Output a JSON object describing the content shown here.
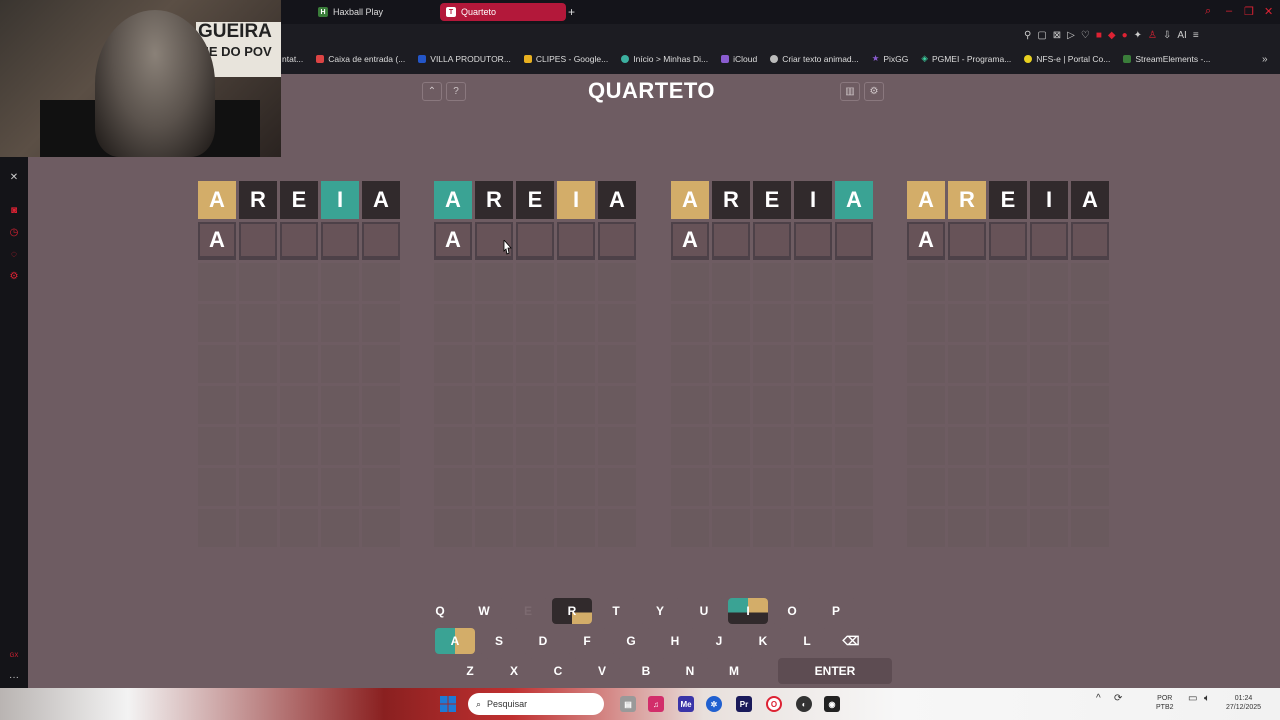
{
  "browser": {
    "tabs": [
      {
        "label": "Haxball Play",
        "favicon": "H",
        "active": false
      },
      {
        "label": "Quarteto",
        "favicon": "T",
        "active": true
      }
    ],
    "new_tab": "+",
    "bookmarks": [
      {
        "label": "ntat..."
      },
      {
        "label": "Caixa de entrada (..."
      },
      {
        "label": "VILLA PRODUTOR..."
      },
      {
        "label": "CLIPES - Google..."
      },
      {
        "label": "Início > Minhas Di..."
      },
      {
        "label": "iCloud"
      },
      {
        "label": "Criar texto animad..."
      },
      {
        "label": "PixGG"
      },
      {
        "label": "PGMEI - Programa..."
      },
      {
        "label": "NFS-e | Portal Co..."
      },
      {
        "label": "StreamElements -..."
      }
    ],
    "more": "»",
    "ai_label": "AI"
  },
  "webcam": {
    "sign_text_1": "GUEIRA",
    "sign_text_2": "ME DO POV"
  },
  "game": {
    "title": "QUARTETO",
    "help_label": "?",
    "up_label": "^",
    "boards": [
      {
        "rows": [
          [
            {
              "l": "A",
              "s": "y"
            },
            {
              "l": "R",
              "s": "b"
            },
            {
              "l": "E",
              "s": "b"
            },
            {
              "l": "I",
              "s": "g"
            },
            {
              "l": "A",
              "s": "b"
            }
          ],
          [
            {
              "l": "A",
              "s": "cur"
            },
            {
              "l": "",
              "s": "cur"
            },
            {
              "l": "",
              "s": "cur"
            },
            {
              "l": "",
              "s": "cur"
            },
            {
              "l": "",
              "s": "cur"
            }
          ]
        ]
      },
      {
        "rows": [
          [
            {
              "l": "A",
              "s": "g"
            },
            {
              "l": "R",
              "s": "b"
            },
            {
              "l": "E",
              "s": "b"
            },
            {
              "l": "I",
              "s": "y"
            },
            {
              "l": "A",
              "s": "b"
            }
          ],
          [
            {
              "l": "A",
              "s": "cur"
            },
            {
              "l": "",
              "s": "cur"
            },
            {
              "l": "",
              "s": "cur"
            },
            {
              "l": "",
              "s": "cur"
            },
            {
              "l": "",
              "s": "cur"
            }
          ]
        ]
      },
      {
        "rows": [
          [
            {
              "l": "A",
              "s": "y"
            },
            {
              "l": "R",
              "s": "b"
            },
            {
              "l": "E",
              "s": "b"
            },
            {
              "l": "I",
              "s": "b"
            },
            {
              "l": "A",
              "s": "g"
            }
          ],
          [
            {
              "l": "A",
              "s": "cur"
            },
            {
              "l": "",
              "s": "cur"
            },
            {
              "l": "",
              "s": "cur"
            },
            {
              "l": "",
              "s": "cur"
            },
            {
              "l": "",
              "s": "cur"
            }
          ]
        ]
      },
      {
        "rows": [
          [
            {
              "l": "A",
              "s": "y"
            },
            {
              "l": "R",
              "s": "y"
            },
            {
              "l": "E",
              "s": "b"
            },
            {
              "l": "I",
              "s": "b"
            },
            {
              "l": "A",
              "s": "b"
            }
          ],
          [
            {
              "l": "A",
              "s": "cur"
            },
            {
              "l": "",
              "s": "cur"
            },
            {
              "l": "",
              "s": "cur"
            },
            {
              "l": "",
              "s": "cur"
            },
            {
              "l": "",
              "s": "cur"
            }
          ]
        ]
      }
    ],
    "keyboard": {
      "row1": [
        "Q",
        "W",
        "E",
        "R",
        "T",
        "Y",
        "U",
        "I",
        "O",
        "P"
      ],
      "row2": [
        "A",
        "S",
        "D",
        "F",
        "G",
        "H",
        "J",
        "K",
        "L"
      ],
      "row3": [
        "Z",
        "X",
        "C",
        "V",
        "B",
        "N",
        "M"
      ],
      "enter": "ENTER",
      "backspace": "⌫"
    }
  },
  "taskbar": {
    "search_placeholder": "Pesquisar",
    "lang": "POR",
    "layout": "PTB2",
    "time": "01:24",
    "date": "27/12/2025"
  },
  "colors": {
    "green": "#3aa394",
    "yellow": "#d3ad69",
    "dark": "#312a2c",
    "bg": "#6e5c62"
  }
}
